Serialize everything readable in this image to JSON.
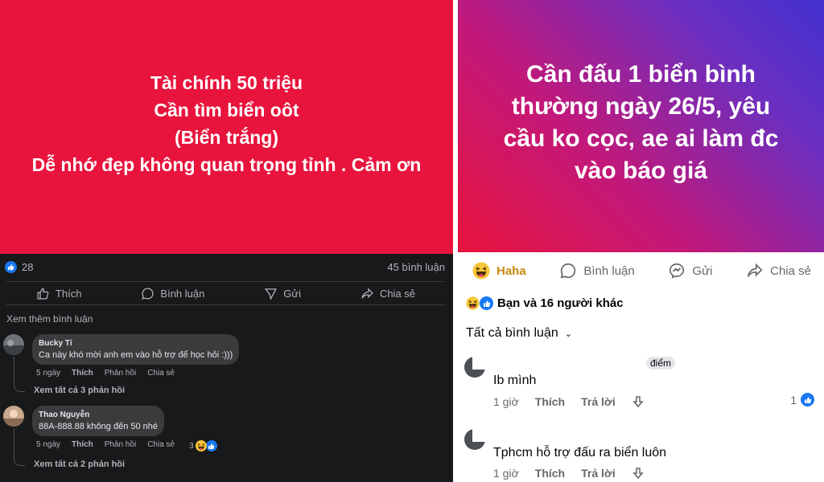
{
  "left_post": {
    "banner_lines": [
      "Tài chính 50 triệu",
      "Cần tìm biển oôt",
      "(Biển trắng)",
      "Dễ nhớ đẹp không quan trọng tỉnh . Cảm ơn"
    ],
    "banner_color": "#e8143d",
    "like_count": "28",
    "comment_count": "45 bình luận",
    "actions": {
      "like": "Thích",
      "comment": "Bình luận",
      "send": "Gửi",
      "share": "Chia sẻ"
    },
    "view_more": "Xem thêm bình luận",
    "comments": [
      {
        "name": "Bucky Tí",
        "text": "Ca này khó mời anh em vào hỗ trợ để học hỏi :)))",
        "time": "5 ngày",
        "like": "Thích",
        "reply": "Phản hồi",
        "share": "Chia sẻ",
        "replies": "Xem tất cả 3 phản hồi"
      },
      {
        "name": "Thao Nguyễn",
        "text": "88A-888.88 không đến 50 nhé",
        "time": "5 ngày",
        "like": "Thích",
        "reply": "Phản hồi",
        "share": "Chia sẻ",
        "reaction_count": "3",
        "replies": "Xem tất cả 2 phản hồi"
      }
    ]
  },
  "right_post": {
    "banner_lines": [
      "Cần đấu 1 biển bình",
      "thường ngày 26/5, yêu",
      "cầu ko cọc, ae ai làm đc",
      "vào báo giá"
    ],
    "actions": {
      "haha": "Haha",
      "comment": "Bình luận",
      "send": "Gửi",
      "share": "Chia sẻ"
    },
    "reaction_summary": "Bạn và 16 người khác",
    "filter": "Tất cả bình luận",
    "comments": [
      {
        "tag": "điểm",
        "text": "Ib mình",
        "time": "1 giờ",
        "like": "Thích",
        "reply": "Trả lời",
        "like_count": "1"
      },
      {
        "text": "Tphcm hỗ trợ đấu ra biển luôn",
        "time": "1 giờ",
        "like": "Thích",
        "reply": "Trả lời"
      }
    ]
  },
  "colors": {
    "fb_blue": "#1877f2",
    "haha_yellow": "#f7c538",
    "haha_text": "#c78a10"
  },
  "icons": [
    "thumbs-up-icon",
    "comment-icon",
    "send-icon",
    "share-icon",
    "messenger-icon",
    "haha-emoji-icon",
    "down-arrow-icon",
    "chevron-down-icon"
  ]
}
